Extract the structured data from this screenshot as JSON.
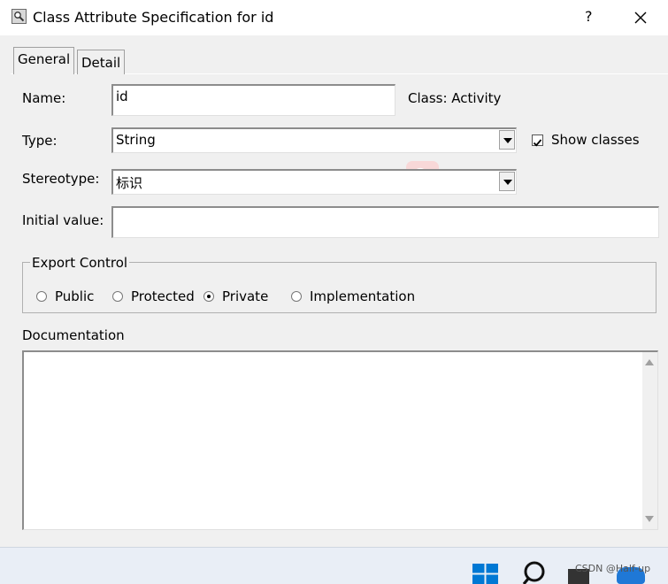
{
  "window": {
    "title": "Class Attribute Specification for id",
    "help_label": "?",
    "close_label": "close"
  },
  "tabs": [
    {
      "label": "General",
      "active": true
    },
    {
      "label": "Detail",
      "active": false
    }
  ],
  "form": {
    "name_label": "Name:",
    "name_value": "id",
    "class_label": "Class: Activity",
    "type_label": "Type:",
    "type_value": "String",
    "show_classes_label": "Show classes",
    "show_classes_checked": true,
    "stereotype_label": "Stereotype:",
    "stereotype_value": "标识",
    "initial_value_label": "Initial value:",
    "initial_value": ""
  },
  "export_control": {
    "legend": "Export Control",
    "options": [
      {
        "label": "Public",
        "selected": false
      },
      {
        "label": "Protected",
        "selected": false
      },
      {
        "label": "Private",
        "selected": true
      },
      {
        "label": "Implementation",
        "selected": false
      }
    ]
  },
  "documentation": {
    "label": "Documentation",
    "value": ""
  },
  "taskbar": {
    "watermark": "CSDN @Half-up"
  },
  "colors": {
    "dialog_bg": "#f0f0f0",
    "taskbar_bg": "#e9eef6",
    "accent_blue": "#0078d4"
  }
}
